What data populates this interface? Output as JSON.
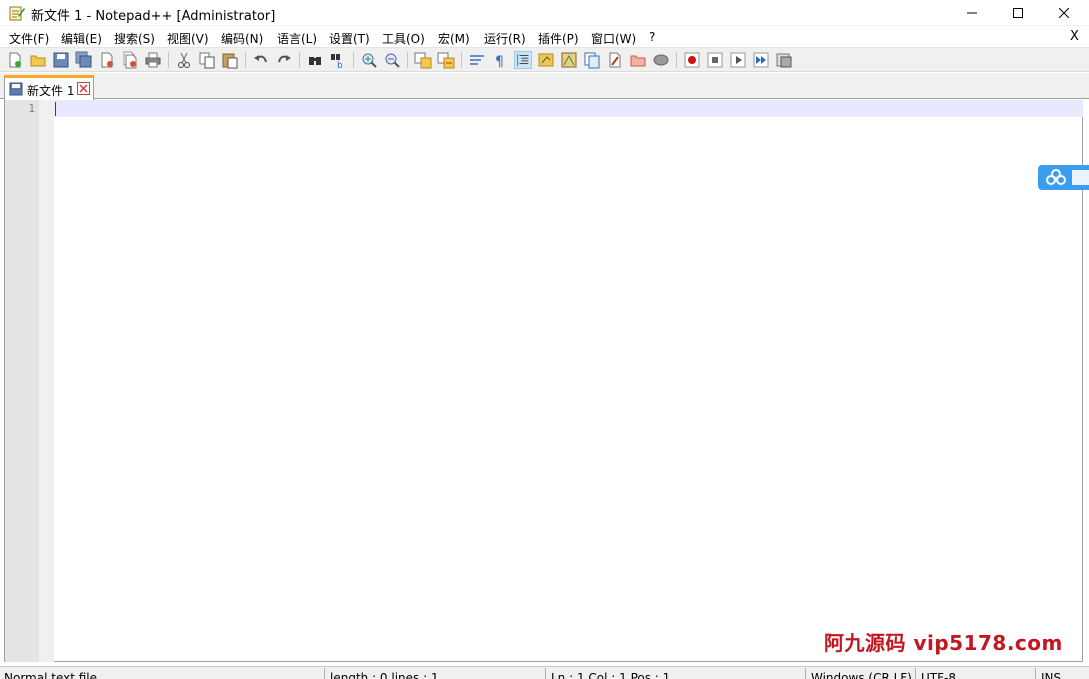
{
  "window": {
    "title": "新文件 1 - Notepad++ [Administrator]",
    "app_icon": "notepad-pencil-icon",
    "controls": [
      "minimize-icon",
      "maximize-icon",
      "close-icon"
    ]
  },
  "menubar": {
    "items": [
      {
        "label": "文件(F)"
      },
      {
        "label": "编辑(E)"
      },
      {
        "label": "搜索(S)"
      },
      {
        "label": "视图(V)"
      },
      {
        "label": "编码(N)"
      },
      {
        "label": "语言(L)"
      },
      {
        "label": "设置(T)"
      },
      {
        "label": "工具(O)"
      },
      {
        "label": "宏(M)"
      },
      {
        "label": "运行(R)"
      },
      {
        "label": "插件(P)"
      },
      {
        "label": "窗口(W)"
      },
      {
        "label": "?"
      }
    ],
    "close_label": "X"
  },
  "toolbar": {
    "icons": [
      "new-file-icon",
      "open-file-icon",
      "save-icon",
      "save-all-icon",
      "close-icon",
      "close-all-icon",
      "print-icon",
      "cut-icon",
      "copy-icon",
      "paste-icon",
      "undo-icon",
      "redo-icon",
      "find-icon",
      "replace-icon",
      "zoom-in-icon",
      "zoom-out-icon",
      "sync-vertical-icon",
      "sync-horizontal-icon",
      "word-wrap-icon",
      "show-all-chars-icon",
      "indent-guide-icon",
      "user-language-icon",
      "document-map-icon",
      "function-list-icon",
      "folder-as-workspace-icon",
      "monitoring-icon",
      "record-macro-icon",
      "stop-record-icon",
      "playback-icon",
      "run-macro-multiple-icon",
      "save-macro-icon"
    ]
  },
  "tabs": [
    {
      "label": "新文件 1",
      "active": true
    }
  ],
  "editor": {
    "line_numbers": [
      "1"
    ],
    "content": ""
  },
  "watermark": {
    "text": "阿九源码  vip5178.com"
  },
  "colors": {
    "tab_accent": "#f5a623",
    "caret": "#8000ff",
    "current_line": "#e8e8ff",
    "watermark": "#c0181e",
    "cloud_widget": "#3b9df0"
  },
  "statusbar": {
    "file_type": "Normal text file",
    "length_lines": "length : 0    lines : 1",
    "position": "Ln : 1    Col : 1    Pos : 1",
    "eol": "Windows (CR LF)",
    "encoding": "UTF-8",
    "mode": "INS"
  }
}
